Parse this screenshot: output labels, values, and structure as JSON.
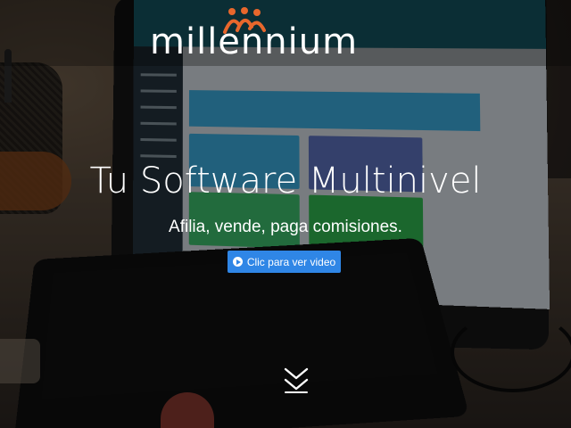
{
  "brand": {
    "logo_text": "millennium",
    "logo_icon": "people-logo-mark"
  },
  "hero": {
    "title": "Tu Software Multinivel",
    "subtitle": "Afilia, vende, paga comisiones.",
    "cta_label": "Clic para ver video",
    "cta_icon": "play-circle-icon",
    "scroll_icon": "double-chevron-down-icon"
  },
  "colors": {
    "accent": "#2f86e6",
    "logo_mark_orange": "#e8672c",
    "text": "#ffffff"
  }
}
